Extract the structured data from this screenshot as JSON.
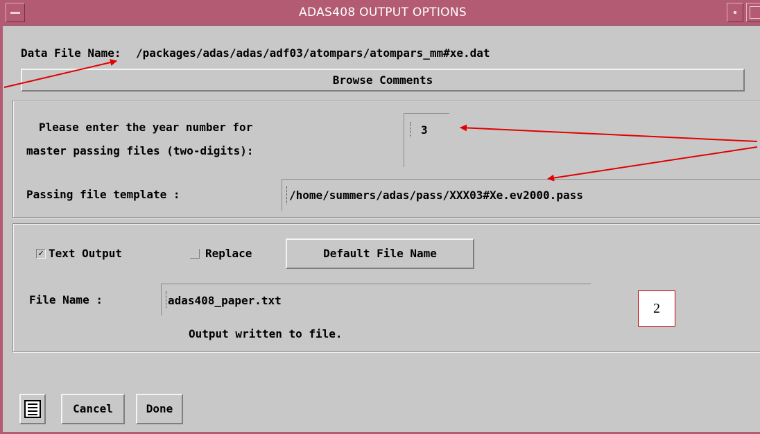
{
  "window": {
    "title": "ADAS408 OUTPUT OPTIONS"
  },
  "data_file": {
    "label": "Data File Name:",
    "path": "/packages/adas/adas/adf03/atompars/atompars_mm#xe.dat"
  },
  "browse_comments": {
    "label": "Browse Comments"
  },
  "passing": {
    "year_prompt_line1": "Please enter the year number for",
    "year_prompt_line2": "master passing files (two-digits):",
    "year_value": "3",
    "template_label": "Passing file template :",
    "template_value": "/home/summers/adas/pass/XXX03#Xe.ev2000.pass"
  },
  "output": {
    "text_output_label": "Text Output",
    "text_output_checked": true,
    "replace_label": "Replace",
    "replace_checked": false,
    "default_file_button": "Default File Name",
    "file_name_label": "File Name :",
    "file_name_value": "adas408_paper.txt",
    "status_message": "Output written to file."
  },
  "annotation": {
    "number": "2"
  },
  "actions": {
    "cancel_label": "Cancel",
    "done_label": "Done",
    "menu_icon": "list-menu-icon"
  },
  "colors": {
    "titlebar": "#b25b73",
    "panel": "#c8c8c8",
    "annotation_red": "#e00000"
  }
}
